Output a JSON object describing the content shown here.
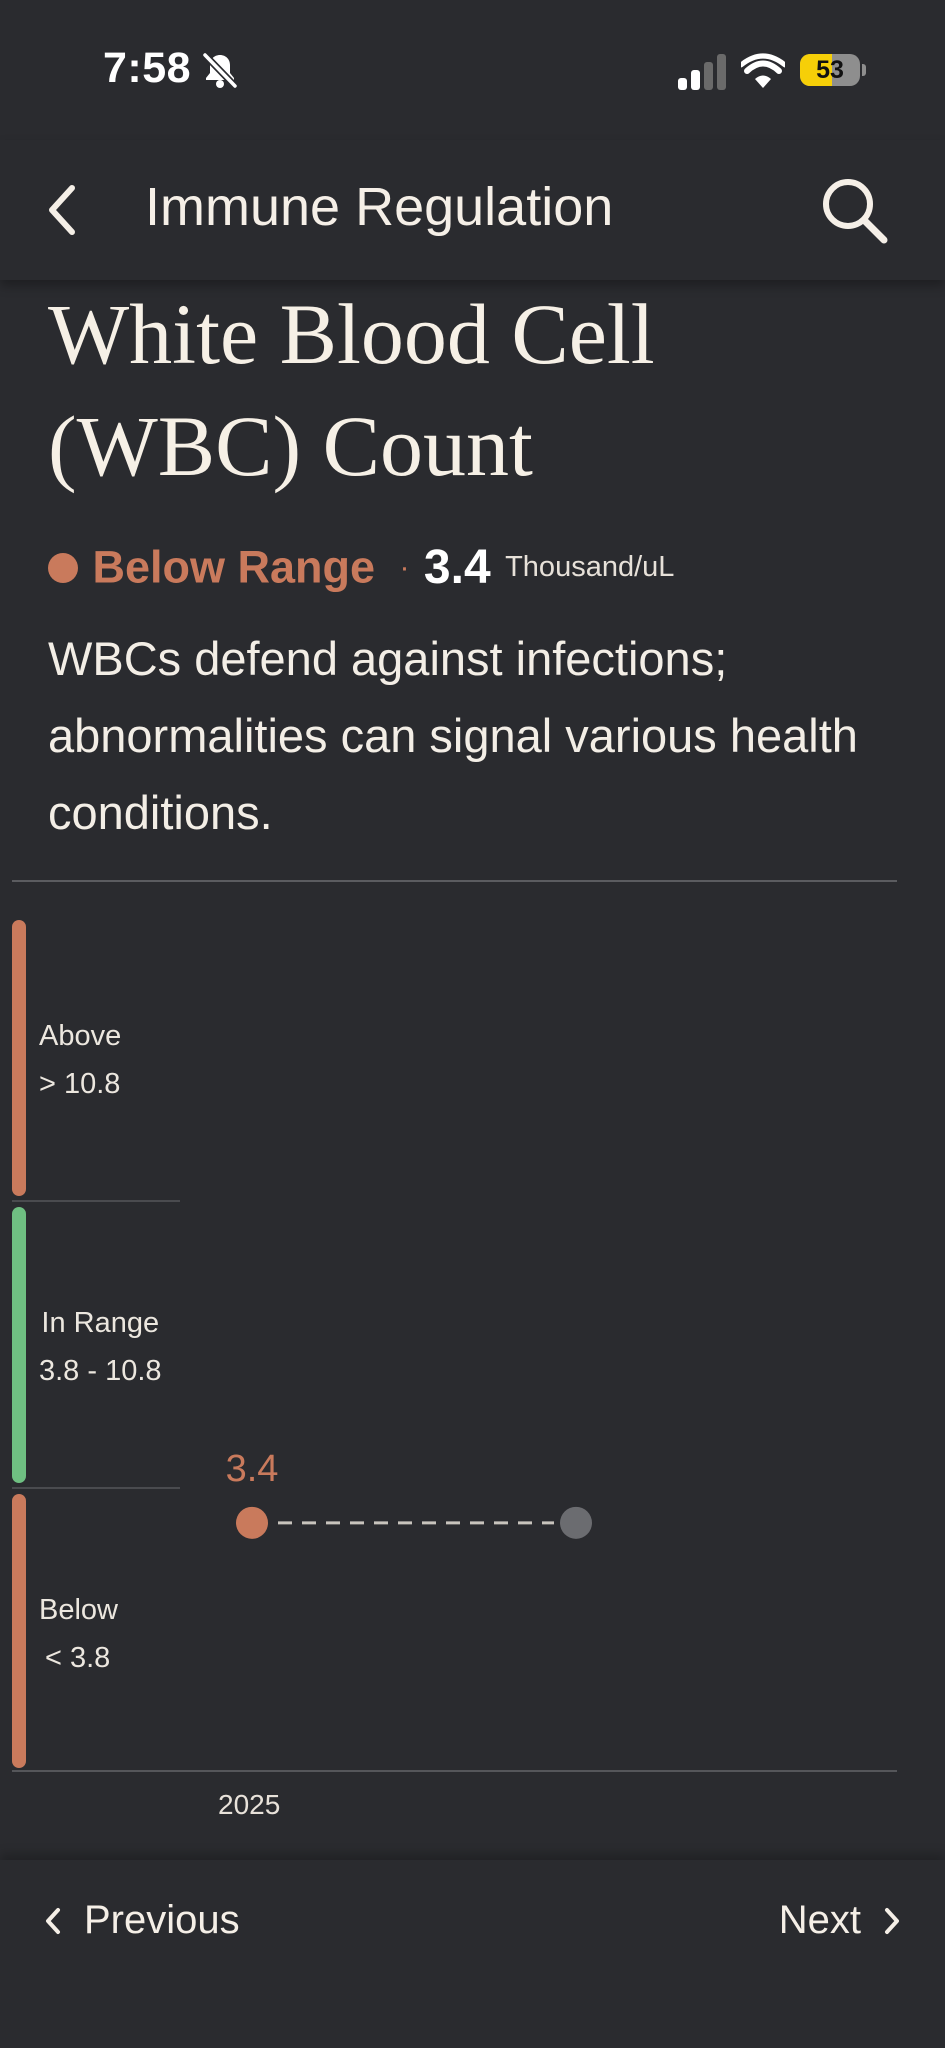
{
  "status_bar": {
    "time": "7:58",
    "battery": "53",
    "battery_level": 0.53
  },
  "header": {
    "title": "Immune Regulation"
  },
  "title": "White Blood Cell (WBC) Count",
  "status": {
    "label": "Below Range",
    "separator": "·",
    "value": "3.4",
    "unit": "Thousand/uL"
  },
  "description": "WBCs defend against infections; abnormalities can signal various health conditions.",
  "ranges": [
    {
      "name": "Above",
      "threshold": "> 10.8",
      "color": "#c97a5c"
    },
    {
      "name": "In Range",
      "threshold": "3.8 - 10.8",
      "color": "#6fbf82"
    },
    {
      "name": "Below",
      "threshold": "< 3.8",
      "color": "#c97a5c"
    }
  ],
  "chart_data": {
    "type": "scatter",
    "x": [
      "2025"
    ],
    "series": [
      {
        "values": [
          3.4
        ]
      }
    ],
    "point_label": "3.4",
    "point_color": "#c97a5c",
    "future_point_color": "#6b6c70",
    "bands": {
      "below_max": 3.8,
      "in_range": [
        3.8,
        10.8
      ],
      "above_min": 10.8
    }
  },
  "nav": {
    "previous": "Previous",
    "next": "Next"
  }
}
